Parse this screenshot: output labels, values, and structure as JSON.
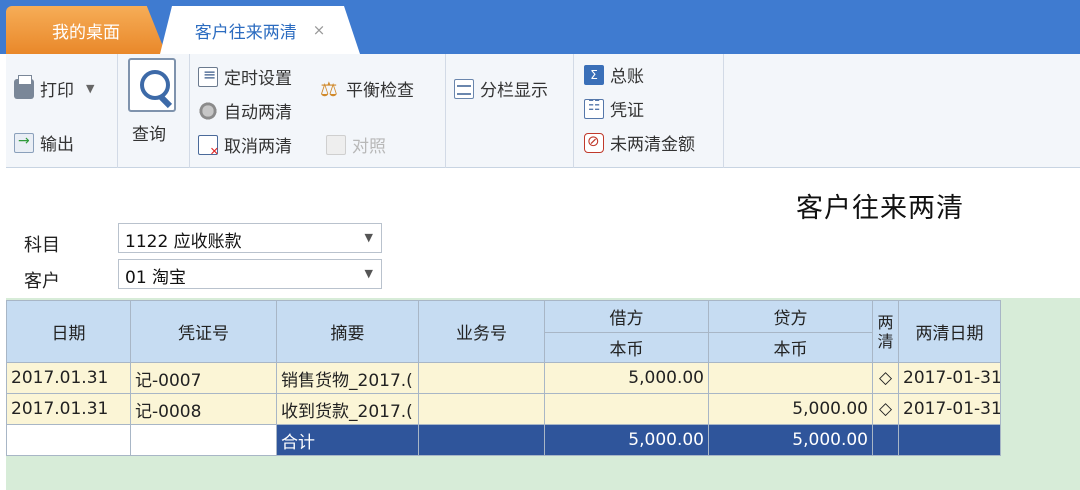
{
  "tabs": {
    "home": "我的桌面",
    "active": "客户往来两清",
    "close": "×"
  },
  "toolbar": {
    "print": "打印",
    "export": "输出",
    "query": "查询",
    "timer_settings": "定时设置",
    "auto_settle": "自动两清",
    "cancel_settle": "取消两清",
    "balance_check": "平衡检查",
    "compare": "对照",
    "column_display": "分栏显示",
    "general_ledger": "总账",
    "voucher": "凭证",
    "unsettled_amount": "未两清金额"
  },
  "report_title": "客户往来两清",
  "filters": {
    "subject_label": "科目",
    "subject_value": "1122 应收账款",
    "customer_label": "客户",
    "customer_value": "01  淘宝"
  },
  "grid": {
    "headers": {
      "date": "日期",
      "voucher_no": "凭证号",
      "summary": "摘要",
      "business_no": "业务号",
      "debit": "借方",
      "debit_currency": "本币",
      "credit": "贷方",
      "credit_currency": "本币",
      "settled": "两清",
      "settle_date": "两清日期"
    },
    "rows": [
      {
        "date": "2017.01.31",
        "voucher_no": "记-0007",
        "summary": "销售货物_2017.(",
        "business_no": "",
        "debit": "5,000.00",
        "credit": "",
        "settled": "◇",
        "settle_date": "2017-01-31"
      },
      {
        "date": "2017.01.31",
        "voucher_no": "记-0008",
        "summary": "收到货款_2017.(",
        "business_no": "",
        "debit": "",
        "credit": "5,000.00",
        "settled": "◇",
        "settle_date": "2017-01-31"
      }
    ],
    "total": {
      "label": "合计",
      "debit": "5,000.00",
      "credit": "5,000.00"
    }
  }
}
